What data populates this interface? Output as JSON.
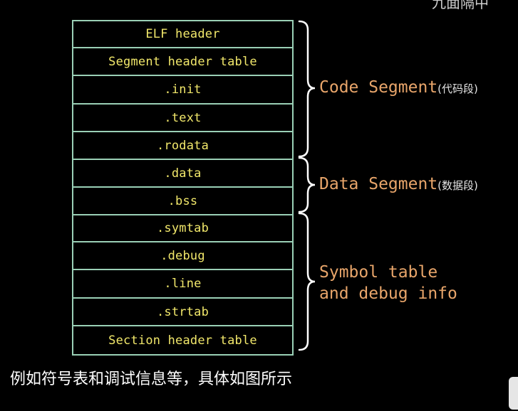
{
  "sections": [
    {
      "label": "ELF header"
    },
    {
      "label": "Segment header table"
    },
    {
      "label": ".init"
    },
    {
      "label": ".text"
    },
    {
      "label": ".rodata"
    },
    {
      "label": ".data"
    },
    {
      "label": ".bss"
    },
    {
      "label": ".symtab"
    },
    {
      "label": ".debug"
    },
    {
      "label": ".line"
    },
    {
      "label": ".strtab"
    },
    {
      "label": "Section header table"
    }
  ],
  "groups": {
    "code": {
      "label": "Code Segment",
      "note": "(代码段)"
    },
    "data": {
      "label": "Data Segment",
      "note": "(数据段)"
    },
    "symbol": {
      "line1": "Symbol table",
      "line2": "and debug info"
    }
  },
  "caption": "例如符号表和调试信息等，具体如图所示",
  "corner_text": "九面隔中",
  "colors": {
    "border": "#9ad0b6",
    "section_text": "#f2e86b",
    "group_text": "#e8a56a",
    "background": "#000000"
  }
}
